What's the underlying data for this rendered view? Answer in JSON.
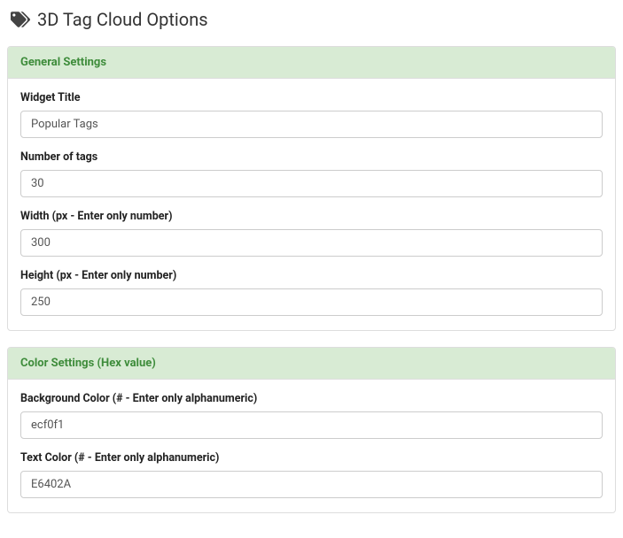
{
  "page": {
    "title": "3D Tag Cloud Options"
  },
  "sections": {
    "general": {
      "heading": "General Settings",
      "fields": {
        "widget_title": {
          "label": "Widget Title",
          "value": "Popular Tags"
        },
        "number_of_tags": {
          "label": "Number of tags",
          "value": "30"
        },
        "width": {
          "label": "Width (px - Enter only number)",
          "value": "300"
        },
        "height": {
          "label": "Height (px - Enter only number)",
          "value": "250"
        }
      }
    },
    "color": {
      "heading": "Color Settings (Hex value)",
      "fields": {
        "background_color": {
          "label": "Background Color (# - Enter only alphanumeric)",
          "value": "ecf0f1"
        },
        "text_color": {
          "label": "Text Color (# - Enter only alphanumeric)",
          "value": "E6402A"
        }
      }
    }
  }
}
